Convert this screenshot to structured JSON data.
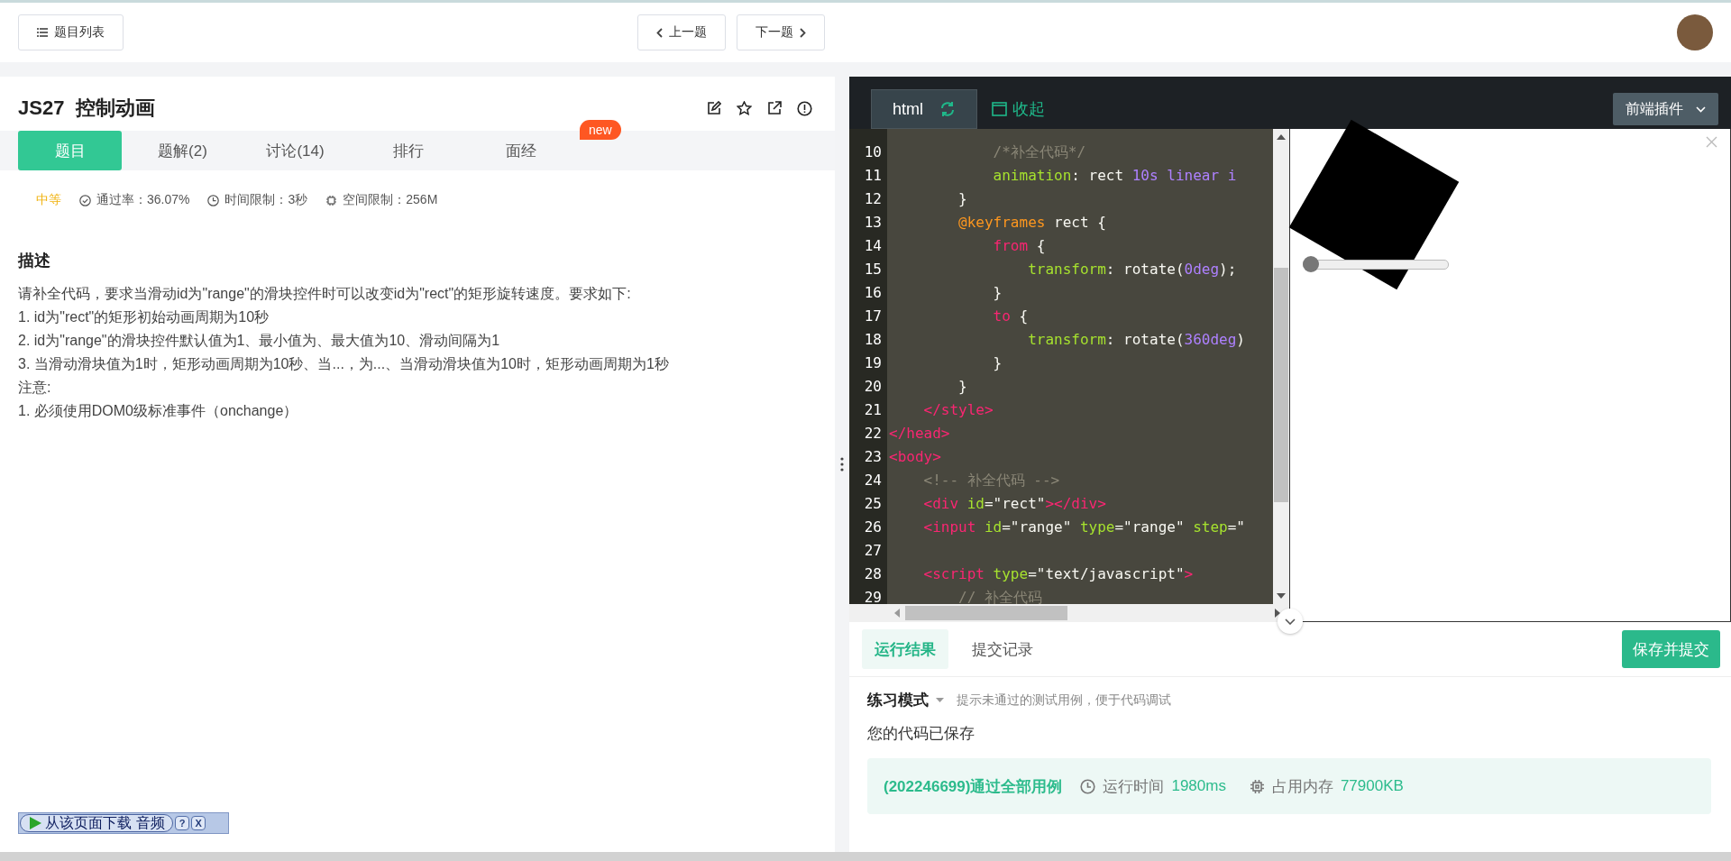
{
  "topbar": {
    "list_button": "题目列表",
    "prev_button": "上一题",
    "next_button": "下一题"
  },
  "problem": {
    "title": "JS27  控制动画",
    "tabs": [
      {
        "label": "题目",
        "selected": true
      },
      {
        "label": "题解(2)",
        "selected": false
      },
      {
        "label": "讨论(14)",
        "selected": false
      },
      {
        "label": "排行",
        "selected": false
      },
      {
        "label": "面经",
        "selected": false,
        "badge": "new"
      }
    ],
    "meta": {
      "difficulty": "中等",
      "pass_rate": "通过率：36.07%",
      "time_limit": "时间限制：3秒",
      "memory_limit": "空间限制：256M"
    },
    "description": {
      "heading": "描述",
      "lines": [
        "请补全代码，要求当滑动id为\"range\"的滑块控件时可以改变id为\"rect\"的矩形旋转速度。要求如下:",
        "1. id为\"rect\"的矩形初始动画周期为10秒",
        "2. id为\"range\"的滑块控件默认值为1、最小值为、最大值为10、滑动间隔为1",
        "3. 当滑动滑块值为1时，矩形动画周期为10秒、当...，为...、当滑动滑块值为10时，矩形动画周期为1秒",
        "注意:",
        "1. 必须使用DOM0级标准事件（onchange）"
      ]
    }
  },
  "download_bar": {
    "label": "从该页面下载 音频",
    "help": "?",
    "close": "X"
  },
  "editor": {
    "tab": "html",
    "collapse": "收起",
    "plugin_menu": "前端插件",
    "lines": [
      {
        "number": "10",
        "tokens": [
          {
            "kind": "comment",
            "text": "            /*补全代码*/"
          }
        ]
      },
      {
        "number": "11",
        "tokens": [
          {
            "kind": "prop",
            "text": "            animation"
          },
          {
            "kind": "plain",
            "text": ": rect "
          },
          {
            "kind": "num",
            "text": "10s linear i"
          }
        ]
      },
      {
        "number": "12",
        "tokens": [
          {
            "kind": "plain",
            "text": "        }"
          }
        ]
      },
      {
        "number": "13",
        "tokens": [
          {
            "kind": "atrule",
            "text": "        @keyframes"
          },
          {
            "kind": "plain",
            "text": " rect {"
          }
        ]
      },
      {
        "number": "14",
        "tokens": [
          {
            "kind": "keyword",
            "text": "            from"
          },
          {
            "kind": "plain",
            "text": " {"
          }
        ]
      },
      {
        "number": "15",
        "tokens": [
          {
            "kind": "prop",
            "text": "                transform"
          },
          {
            "kind": "plain",
            "text": ": rotate("
          },
          {
            "kind": "num",
            "text": "0deg"
          },
          {
            "kind": "plain",
            "text": ");"
          }
        ]
      },
      {
        "number": "16",
        "tokens": [
          {
            "kind": "plain",
            "text": "            }"
          }
        ]
      },
      {
        "number": "17",
        "tokens": [
          {
            "kind": "keyword",
            "text": "            to"
          },
          {
            "kind": "plain",
            "text": " {"
          }
        ]
      },
      {
        "number": "18",
        "tokens": [
          {
            "kind": "prop",
            "text": "                transform"
          },
          {
            "kind": "plain",
            "text": ": rotate("
          },
          {
            "kind": "num",
            "text": "360deg"
          },
          {
            "kind": "plain",
            "text": ")"
          }
        ]
      },
      {
        "number": "19",
        "tokens": [
          {
            "kind": "plain",
            "text": "            }"
          }
        ]
      },
      {
        "number": "20",
        "tokens": [
          {
            "kind": "plain",
            "text": "        }"
          }
        ]
      },
      {
        "number": "21",
        "tokens": [
          {
            "kind": "tag",
            "text": "    </style>"
          }
        ]
      },
      {
        "number": "22",
        "tokens": [
          {
            "kind": "tag",
            "text": "</head>"
          }
        ]
      },
      {
        "number": "23",
        "tokens": [
          {
            "kind": "tag",
            "text": "<body>"
          }
        ]
      },
      {
        "number": "24",
        "tokens": [
          {
            "kind": "comment",
            "text": "    <!-- 补全代码 -->"
          }
        ]
      },
      {
        "number": "25",
        "tokens": [
          {
            "kind": "tag",
            "text": "    <div"
          },
          {
            "kind": "attr",
            "text": " id"
          },
          {
            "kind": "plain",
            "text": "=\"rect\""
          },
          {
            "kind": "tag",
            "text": "></div>"
          }
        ]
      },
      {
        "number": "26",
        "tokens": [
          {
            "kind": "tag",
            "text": "    <input"
          },
          {
            "kind": "attr",
            "text": " id"
          },
          {
            "kind": "plain",
            "text": "=\"range\" "
          },
          {
            "kind": "attr",
            "text": "type"
          },
          {
            "kind": "plain",
            "text": "=\"range\" "
          },
          {
            "kind": "attr",
            "text": "step"
          },
          {
            "kind": "plain",
            "text": "=\""
          }
        ]
      },
      {
        "number": "27"
      },
      {
        "number": "28",
        "tokens": [
          {
            "kind": "tag",
            "text": "    <script"
          },
          {
            "kind": "attr",
            "text": " type"
          },
          {
            "kind": "plain",
            "text": "=\"text/javascript\""
          },
          {
            "kind": "tag",
            "text": ">"
          }
        ]
      },
      {
        "number": "29",
        "tokens": [
          {
            "kind": "comment",
            "text": "        // 补全代码"
          }
        ]
      }
    ]
  },
  "preview": {
    "slider": {
      "level": 0
    }
  },
  "result": {
    "tabs": [
      {
        "label": "运行结果",
        "selected": true
      },
      {
        "label": "提交记录",
        "selected": false
      }
    ],
    "submit_button": "保存并提交",
    "mode": "练习模式",
    "mode_hint": "提示未通过的测试用例，便于代码调试",
    "saved_message": "您的代码已保存",
    "summary": "(202246699)通过全部用例",
    "runtime_label": "运行时间",
    "runtime": "1980ms",
    "memory_label": "占用内存",
    "memory": "77900KB"
  }
}
